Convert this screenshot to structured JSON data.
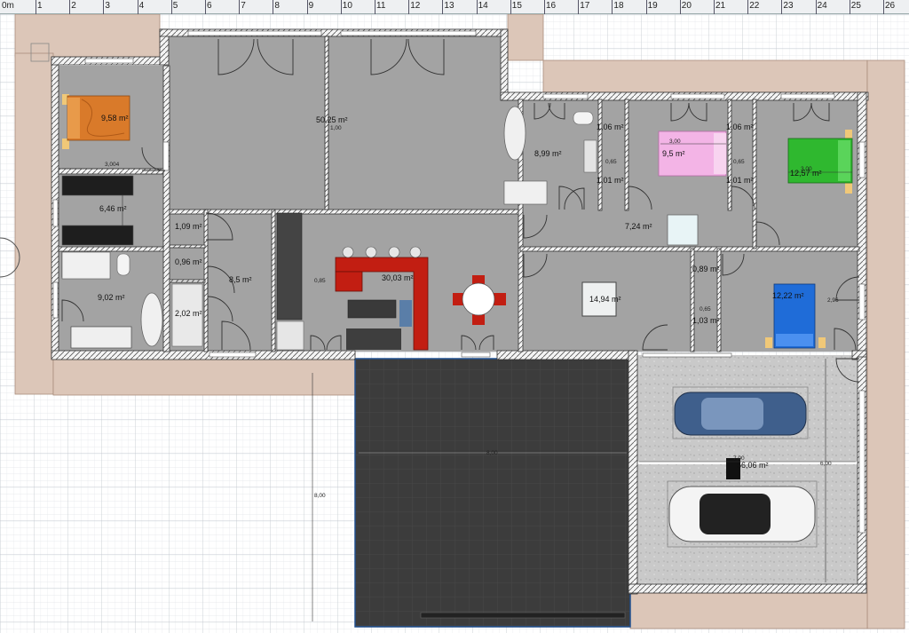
{
  "ruler": {
    "origin_label": "0m",
    "ticks": [
      "1",
      "2",
      "3",
      "4",
      "5",
      "6",
      "7",
      "8",
      "9",
      "10",
      "11",
      "12",
      "13",
      "14",
      "15",
      "16",
      "17",
      "18",
      "19",
      "20",
      "21",
      "22",
      "23",
      "24",
      "25",
      "26"
    ]
  },
  "rooms": {
    "bedroom_orange": "9,58 m²",
    "living_room": "50,25 m²",
    "bathroom_top": "8,99 m²",
    "wc_top": "1,06 m²",
    "small_top_1": "1,01 m²",
    "bedroom_pink": "9,5 m²",
    "wc_top_2": "1,06 m²",
    "small_top_2": "1,01 m²",
    "bedroom_green": "12,57 m²",
    "closet_left": "6,46 m²",
    "hallway": "7,24 m²",
    "storage_1": "1,09 m²",
    "storage_2": "0,96 m²",
    "shower": "2,02 m²",
    "corridor": "8,5 m²",
    "kitchen": "30,03 m²",
    "bathroom_left": "9,02 m²",
    "office": "14,94 m²",
    "small_mid_1": "0,89 m²",
    "small_mid_2": "1,03 m²",
    "bedroom_blue": "12,22 m²",
    "garage": "56,06 m²"
  },
  "dimensions": {
    "d_3004": "3,004",
    "d_300a": "3,00",
    "d_300b": "3,00",
    "d_065a": "0,65",
    "d_065b": "0,65",
    "d_065c": "0,65",
    "d_065d": "0,85",
    "d_296": "2,96",
    "d_800v": "8,00",
    "d_800h": "8,00",
    "d_700": "7,00",
    "d_600": "6,00",
    "d_100": "1,00"
  },
  "colors": {
    "floor": "#a3a3a3",
    "wall": "#f2f2f2",
    "outdoor": "#dcc6b8",
    "terrace": "#3a3a3a",
    "garage_floor": "#c8c8c8",
    "grid": "#d4d8de"
  }
}
